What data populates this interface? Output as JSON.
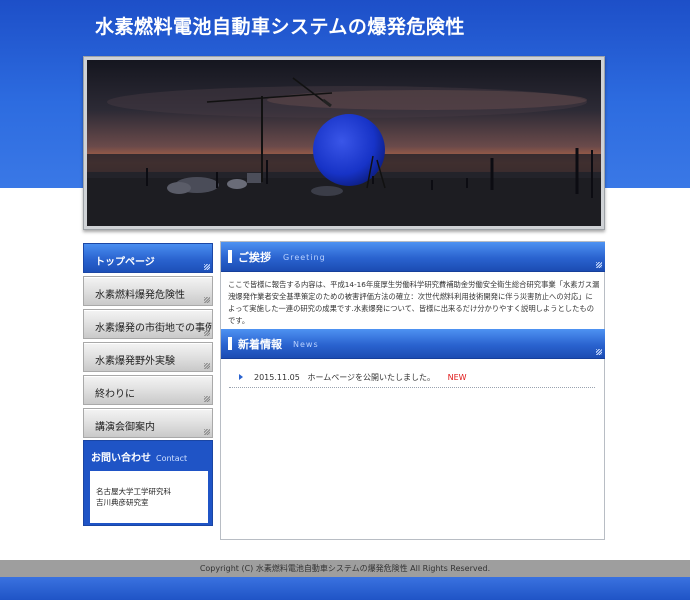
{
  "site": {
    "title": "水素燃料電池自動車システムの爆発危険性"
  },
  "hero": {
    "image_icon": "photo-icon"
  },
  "nav": {
    "items": [
      {
        "label": "トップページ",
        "active": true
      },
      {
        "label": "水素燃料爆発危険性",
        "active": false
      },
      {
        "label": "水素爆発の市街地での事例",
        "active": false
      },
      {
        "label": "水素爆発野外実験",
        "active": false
      },
      {
        "label": "終わりに",
        "active": false
      },
      {
        "label": "講演会御案内",
        "active": false
      }
    ]
  },
  "contact": {
    "title": "お問い合わせ",
    "title_en": "Contact",
    "lines": [
      "名古屋大学工学研究科",
      "吉川典彦研究室"
    ]
  },
  "greeting": {
    "title": "ご挨拶",
    "title_en": "Greeting",
    "text": "ここで皆様に報告する内容は、平成14-16年度厚生労働科学研究費補助金労働安全衛生総合研究事業「水素ガス漏洩爆発作業者安全基準策定のための被害評価方法の確立：次世代燃料利用技術開発に伴う災害防止への対応」によって実施した一連の研究の成果です.水素爆発について、皆様に出来るだけ分かりやすく説明しようとしたものです。"
  },
  "news": {
    "title": "新着情報",
    "title_en": "News",
    "items": [
      {
        "date": "2015.11.05",
        "text": "ホームページを公開いたしました。",
        "badge": "NEW"
      }
    ]
  },
  "footer": {
    "copyright": "Copyright (C) 水素燃料電池自動車システムの爆発危険性 All Rights Reserved."
  },
  "colors": {
    "accent": "#2a63cf",
    "header_blue": "#2d6ce0",
    "new_badge": "#e01818"
  }
}
